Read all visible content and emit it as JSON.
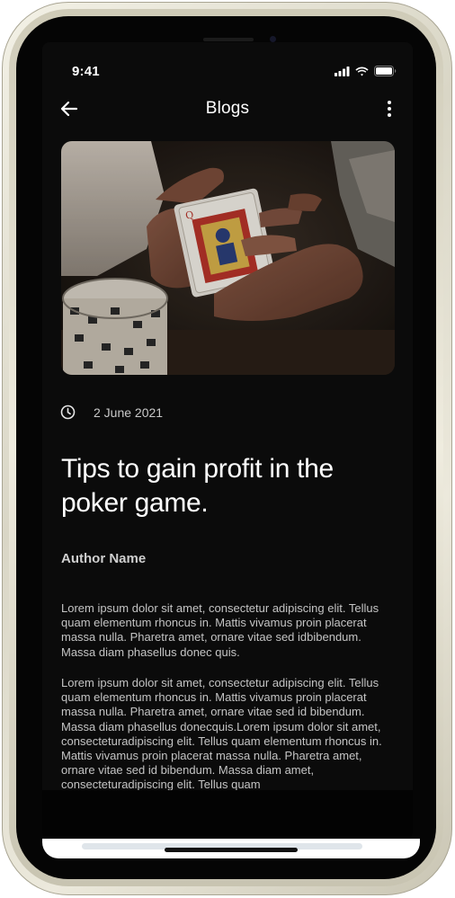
{
  "status_bar": {
    "time": "9:41"
  },
  "header": {
    "title": "Blogs",
    "back_icon": "arrow-left-icon",
    "more_icon": "more-vertical-icon"
  },
  "post": {
    "image": "playing-cards-photo",
    "date_icon": "clock-icon",
    "date": "2 June 2021",
    "title": "Tips to gain profit in the poker game.",
    "author": "Author Name",
    "paragraphs": [
      "Lorem ipsum dolor sit amet, consectetur adipiscing elit. Tellus quam elementum rhoncus in. Mattis vivamus proin placerat massa nulla. Pharetra amet, ornare vitae sed idbibendum. Massa diam phasellus donec quis.",
      "Lorem ipsum dolor sit amet, consectetur adipiscing elit. Tellus quam elementum rhoncus in. Mattis vivamus proin placerat massa nulla. Pharetra amet, ornare vitae sed id bibendum. Massa diam phasellus donecquis.Lorem ipsum dolor sit amet, consecteturadipiscing elit. Tellus quam elementum rhoncus in. Mattis vivamus proin placerat massa nulla. Pharetra amet, ornare vitae sed id bibendum. Massa diam amet, consecteturadipiscing elit. Tellus quam"
    ]
  },
  "colors": {
    "background": "#0b0b0b",
    "text": "#ffffff",
    "muted": "#c4c4c4"
  }
}
